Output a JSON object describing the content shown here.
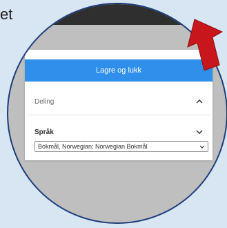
{
  "background_text": "et",
  "panel": {
    "save_button": "Lagre og lukk",
    "sharing_section": "Deling",
    "language_section": "Språk",
    "language_value": "Bokmål, Norwegian; Norwegian Bokmål"
  },
  "colors": {
    "accent": "#2f8fea",
    "arrow": "#c8161d",
    "circle_border": "#1e3d7a"
  },
  "icons": [
    "chevron-up-icon",
    "chevron-down-icon",
    "select-caret-icon",
    "red-arrow-icon"
  ]
}
